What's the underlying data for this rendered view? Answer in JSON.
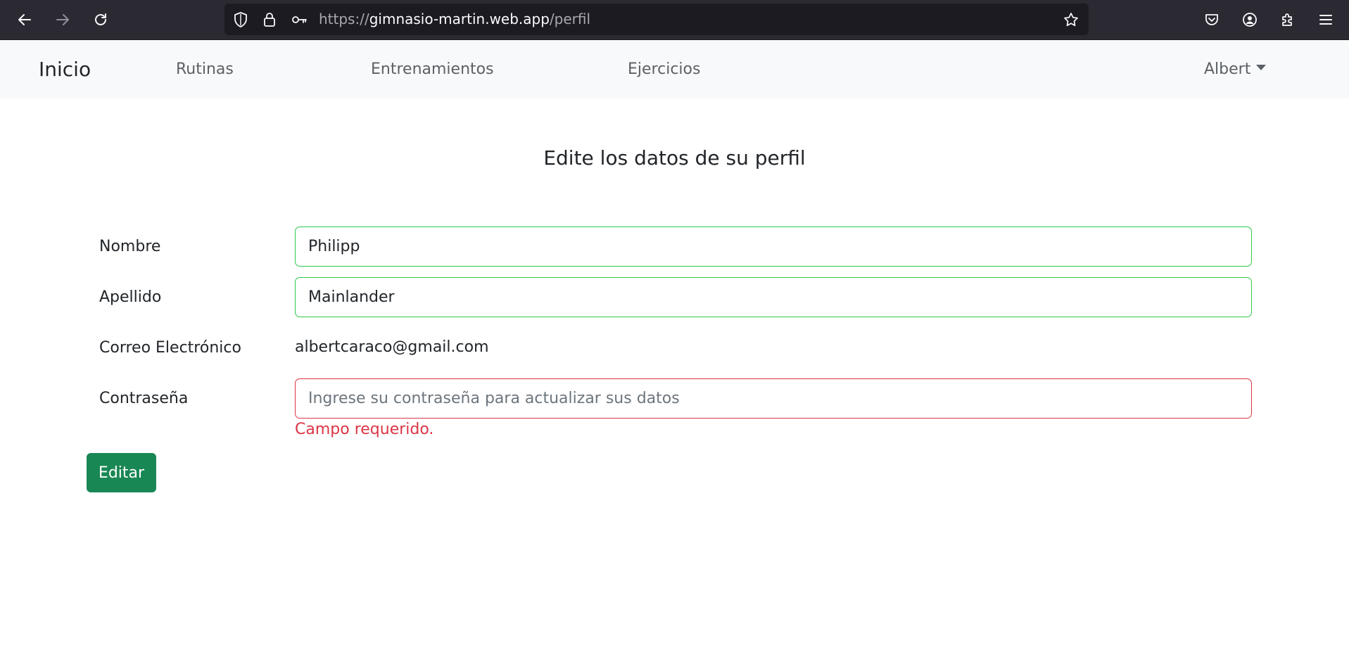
{
  "browser": {
    "url_scheme": "https://",
    "url_host": "gimnasio-martin.web.app",
    "url_path": "/perfil",
    "icons": [
      "back-arrow-icon",
      "forward-arrow-icon",
      "reload-icon",
      "shield-icon",
      "lock-icon",
      "key-icon",
      "bookmark-star-icon",
      "pocket-icon",
      "account-icon",
      "extensions-icon",
      "menu-icon"
    ]
  },
  "navbar": {
    "brand": "Inicio",
    "links": [
      "Rutinas",
      "Entrenamientos",
      "Ejercicios"
    ],
    "user": "Albert"
  },
  "main": {
    "title": "Edite los datos de su perfil",
    "fields": {
      "nombre": {
        "label": "Nombre",
        "value": "Philipp"
      },
      "apellido": {
        "label": "Apellido",
        "value": "Mainlander"
      },
      "correo": {
        "label": "Correo Electrónico",
        "value": "albertcaraco@gmail.com"
      },
      "contrasena": {
        "label": "Contraseña",
        "value": "",
        "placeholder": "Ingrese su contraseña para actualizar sus datos",
        "error": "Campo requerido."
      }
    },
    "submit_label": "Editar"
  },
  "colors": {
    "valid_border": "#2ec94a",
    "invalid_border": "#dc3545",
    "primary_button": "#198754",
    "navbar_bg": "#f8f9fa",
    "chrome_bg": "#2b2a33"
  }
}
